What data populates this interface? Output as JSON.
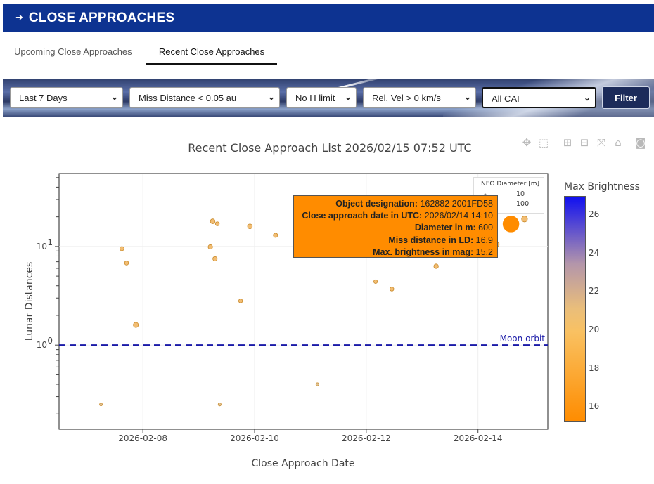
{
  "header": {
    "arrow": "➜",
    "title": "CLOSE APPROACHES"
  },
  "tabs": [
    {
      "label": "Upcoming Close Approaches",
      "active": false
    },
    {
      "label": "Recent Close Approaches",
      "active": true
    }
  ],
  "filters": {
    "time_range": "Last 7 Days",
    "miss_distance": "Miss Distance < 0.05 au",
    "h_limit": "No H limit",
    "rel_velocity": "Rel. Vel > 0 km/s",
    "cai": "All CAI",
    "filter_button": "Filter"
  },
  "modebar": [
    "pan-icon",
    "box-select-icon",
    "zoom-in-icon",
    "zoom-out-icon",
    "autoscale-icon",
    "reset-home-icon",
    "camera-icon"
  ],
  "colors": {
    "header": "#0d3391",
    "marker_fill": "#f0b25a",
    "marker_stroke": "#c98a2a",
    "moon_line": "#1a1aa8",
    "tooltip_bg": "#ff8c00"
  },
  "chart_data": {
    "type": "scatter",
    "title": "Recent Close Approach List 2026/02/15 07:52 UTC",
    "xlabel": "Close Approach Date",
    "ylabel": "Lunar Distances",
    "x_ticks": [
      "2026-02-08",
      "2026-02-10",
      "2026-02-12",
      "2026-02-14"
    ],
    "y_scale": "log",
    "y_ticks": [
      {
        "value": 1,
        "base": "10",
        "exp": "0"
      },
      {
        "value": 10,
        "base": "10",
        "exp": "1"
      }
    ],
    "xlim": [
      "2026-02-06 12:00",
      "2026-02-15 06:00"
    ],
    "ylim": [
      0.14,
      55
    ],
    "grid": true,
    "moon_orbit": {
      "y": 1,
      "label": "Moon orbit"
    },
    "size_legend": {
      "title": "NEO Diameter [m]",
      "entries": [
        {
          "label": "10",
          "diameter_m": 10
        },
        {
          "label": "100",
          "diameter_m": 100
        }
      ]
    },
    "colorbar": {
      "title": "Max Brightness",
      "ticks": [
        16,
        18,
        20,
        22,
        24,
        26
      ],
      "range": [
        15.2,
        27
      ],
      "low_color": "#ff8c00",
      "high_color": "#1010f0"
    },
    "points": [
      {
        "date": "2026-02-07 06:00",
        "ld": 0.25,
        "diameter_m": 4,
        "mag": 27
      },
      {
        "date": "2026-02-07 15:00",
        "ld": 9.5,
        "diameter_m": 15,
        "mag": 21
      },
      {
        "date": "2026-02-07 17:00",
        "ld": 6.8,
        "diameter_m": 14,
        "mag": 21
      },
      {
        "date": "2026-02-07 21:00",
        "ld": 1.6,
        "diameter_m": 25,
        "mag": 19
      },
      {
        "date": "2026-02-09 05:00",
        "ld": 9.9,
        "diameter_m": 17,
        "mag": 21
      },
      {
        "date": "2026-02-09 06:00",
        "ld": 18,
        "diameter_m": 20,
        "mag": 21
      },
      {
        "date": "2026-02-09 07:00",
        "ld": 7.5,
        "diameter_m": 17,
        "mag": 21
      },
      {
        "date": "2026-02-09 08:00",
        "ld": 17,
        "diameter_m": 12,
        "mag": 22
      },
      {
        "date": "2026-02-09 09:00",
        "ld": 0.25,
        "diameter_m": 5,
        "mag": 27
      },
      {
        "date": "2026-02-09 18:00",
        "ld": 2.8,
        "diameter_m": 12,
        "mag": 22
      },
      {
        "date": "2026-02-09 22:00",
        "ld": 16,
        "diameter_m": 20,
        "mag": 20
      },
      {
        "date": "2026-02-10 09:00",
        "ld": 13,
        "diameter_m": 16,
        "mag": 21
      },
      {
        "date": "2026-02-11 03:00",
        "ld": 0.4,
        "diameter_m": 5,
        "mag": 27
      },
      {
        "date": "2026-02-12 04:00",
        "ld": 4.4,
        "diameter_m": 10,
        "mag": 22
      },
      {
        "date": "2026-02-12 11:00",
        "ld": 3.7,
        "diameter_m": 12,
        "mag": 22
      },
      {
        "date": "2026-02-13 06:00",
        "ld": 6.3,
        "diameter_m": 18,
        "mag": 20
      },
      {
        "date": "2026-02-14 08:00",
        "ld": 10.5,
        "diameter_m": 25,
        "mag": 19
      },
      {
        "date": "2026-02-14 14:10",
        "ld": 16.9,
        "diameter_m": 600,
        "mag": 15.2
      },
      {
        "date": "2026-02-14 20:00",
        "ld": 19,
        "diameter_m": 35,
        "mag": 18
      }
    ],
    "hover": {
      "designation_label": "Object designation:",
      "designation": "162882 2001FD58",
      "date_label": "Close approach date in UTC:",
      "date": "2026/02/14 14:10",
      "diameter_label": "Diameter in m:",
      "diameter": "600",
      "miss_label": "Miss distance in LD:",
      "miss": "16.9",
      "mag_label": "Max. brightness in mag:",
      "mag": "15.2"
    }
  }
}
